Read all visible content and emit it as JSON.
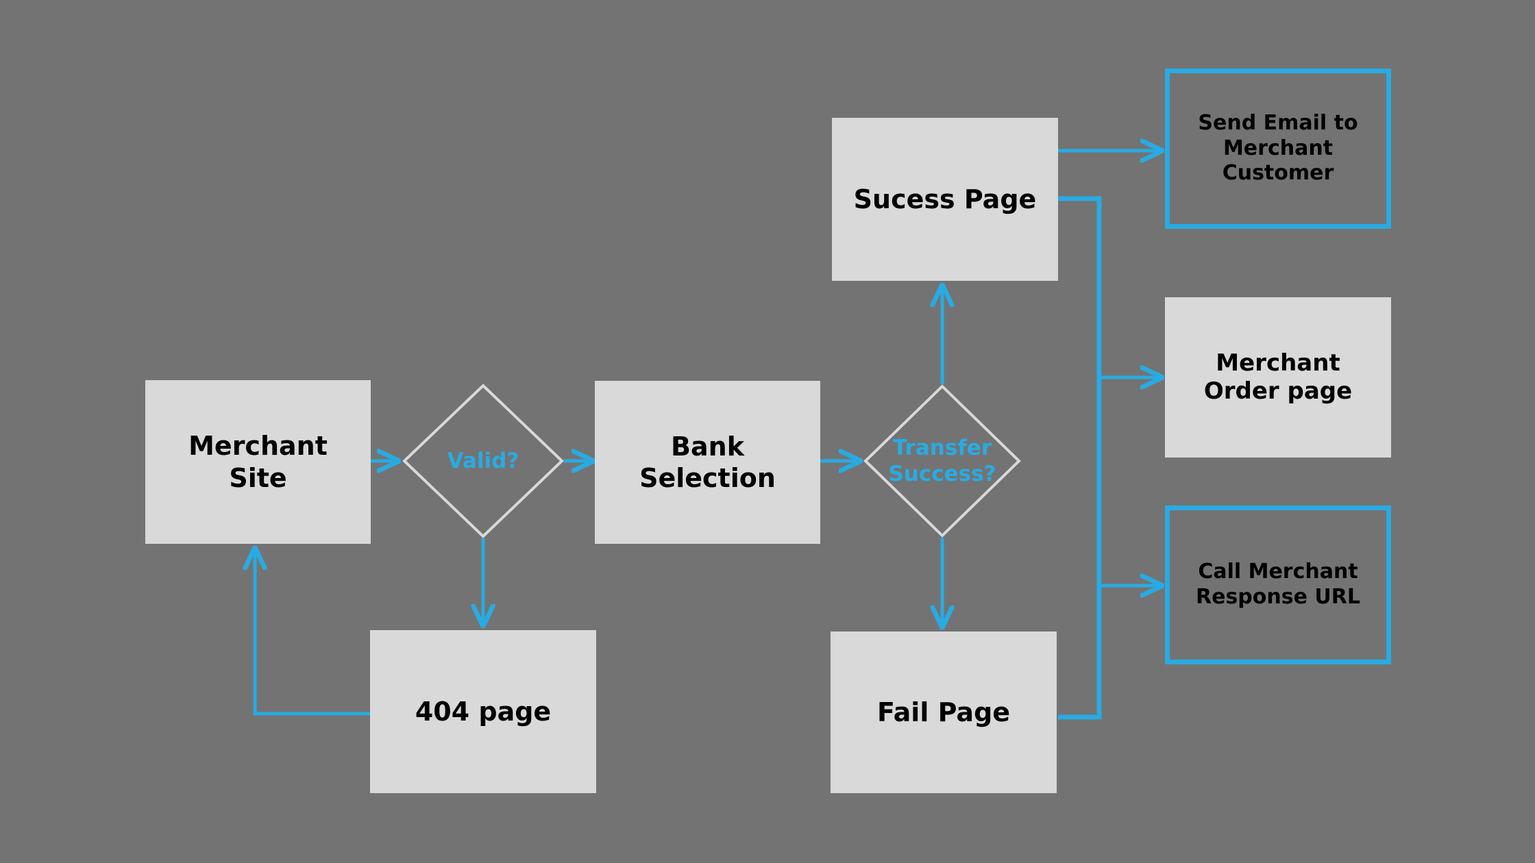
{
  "diagram": {
    "type": "flowchart",
    "title": "Payment gateway merchant checkout flow",
    "colors": {
      "background": "#737373",
      "node_fill": "#D9D9D9",
      "node_text": "#000000",
      "accent": "#29ABE2",
      "diamond_stroke": "#D9D9D9",
      "diamond_text": "#29ABE2"
    }
  },
  "nodes": {
    "merchant_site": {
      "label": "Merchant\nSite",
      "shape": "rectangle",
      "style": "filled"
    },
    "valid": {
      "label": "Valid?",
      "shape": "diamond",
      "style": "outline"
    },
    "bank_selection": {
      "label": "Bank\nSelection",
      "shape": "rectangle",
      "style": "filled"
    },
    "transfer_success": {
      "label": "Transfer\nSuccess?",
      "shape": "diamond",
      "style": "outline"
    },
    "success_page": {
      "label": "Sucess Page",
      "shape": "rectangle",
      "style": "filled"
    },
    "fail_page": {
      "label": "Fail Page",
      "shape": "rectangle",
      "style": "filled"
    },
    "page_404": {
      "label": "404 page",
      "shape": "rectangle",
      "style": "filled"
    },
    "send_email": {
      "label": "Send Email to\nMerchant\nCustomer",
      "shape": "rectangle",
      "style": "blue-outline"
    },
    "merchant_order_page": {
      "label": "Merchant\nOrder page",
      "shape": "rectangle",
      "style": "filled"
    },
    "call_response_url": {
      "label": "Call Merchant\nResponse URL",
      "shape": "rectangle",
      "style": "blue-outline"
    }
  },
  "edges": [
    {
      "from": "merchant_site",
      "to": "valid",
      "label": ""
    },
    {
      "from": "valid",
      "to": "bank_selection",
      "label": ""
    },
    {
      "from": "valid",
      "to": "page_404",
      "label": ""
    },
    {
      "from": "page_404",
      "to": "merchant_site",
      "label": ""
    },
    {
      "from": "bank_selection",
      "to": "transfer_success",
      "label": ""
    },
    {
      "from": "transfer_success",
      "to": "success_page",
      "label": ""
    },
    {
      "from": "transfer_success",
      "to": "fail_page",
      "label": ""
    },
    {
      "from": "success_page",
      "to": "send_email",
      "label": ""
    },
    {
      "from": "success_page",
      "to": "merchant_order_page",
      "label": ""
    },
    {
      "from": "fail_page",
      "to": "call_response_url",
      "label": ""
    }
  ]
}
